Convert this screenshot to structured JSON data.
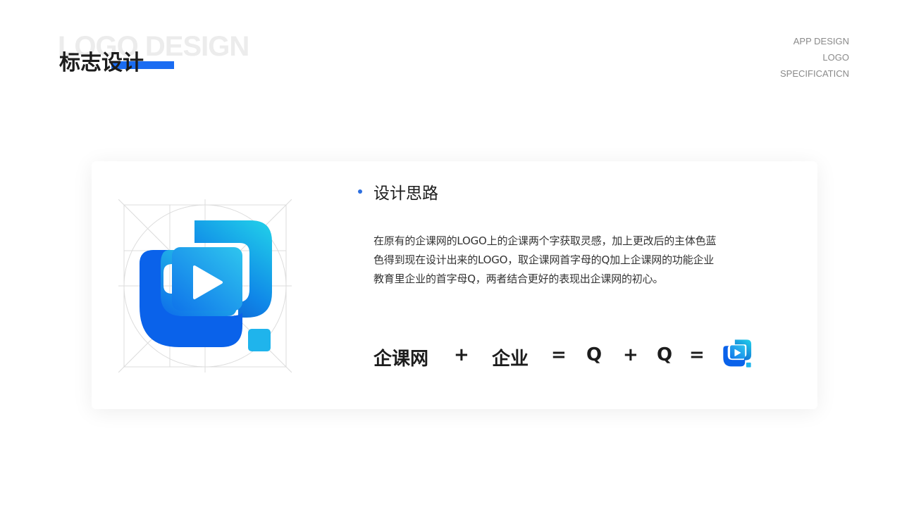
{
  "header": {
    "bg_title": "LOGO DESIGN",
    "title": "标志设计",
    "right_lines": [
      "APP DESIGN",
      "LOGO",
      "SPECIFICATICN"
    ]
  },
  "card": {
    "section_title": "设计思路",
    "description": "在原有的企课网的LOGO上的企课两个字获取灵感，加上更改后的主体色蓝色得到现在设计出来的LOGO，取企课网首字母的Q加上企课网的功能企业教育里企业的首字母Q，两者结合更好的表现出企课网的初心。",
    "formula": {
      "term1": "企课网",
      "plus1": "+",
      "term2": "企业",
      "eq1": "=",
      "q1": "Q",
      "plus2": "+",
      "q2": "Q",
      "eq2": "="
    }
  },
  "colors": {
    "accent": "#1a6cf2",
    "logo_gradient_start": "#26d4e8",
    "logo_gradient_end": "#0a5ae8",
    "logo_dot": "#1fb4ec"
  },
  "icons": {
    "main_logo": "play-q-logo-icon",
    "mini_logo": "play-q-logo-icon"
  }
}
